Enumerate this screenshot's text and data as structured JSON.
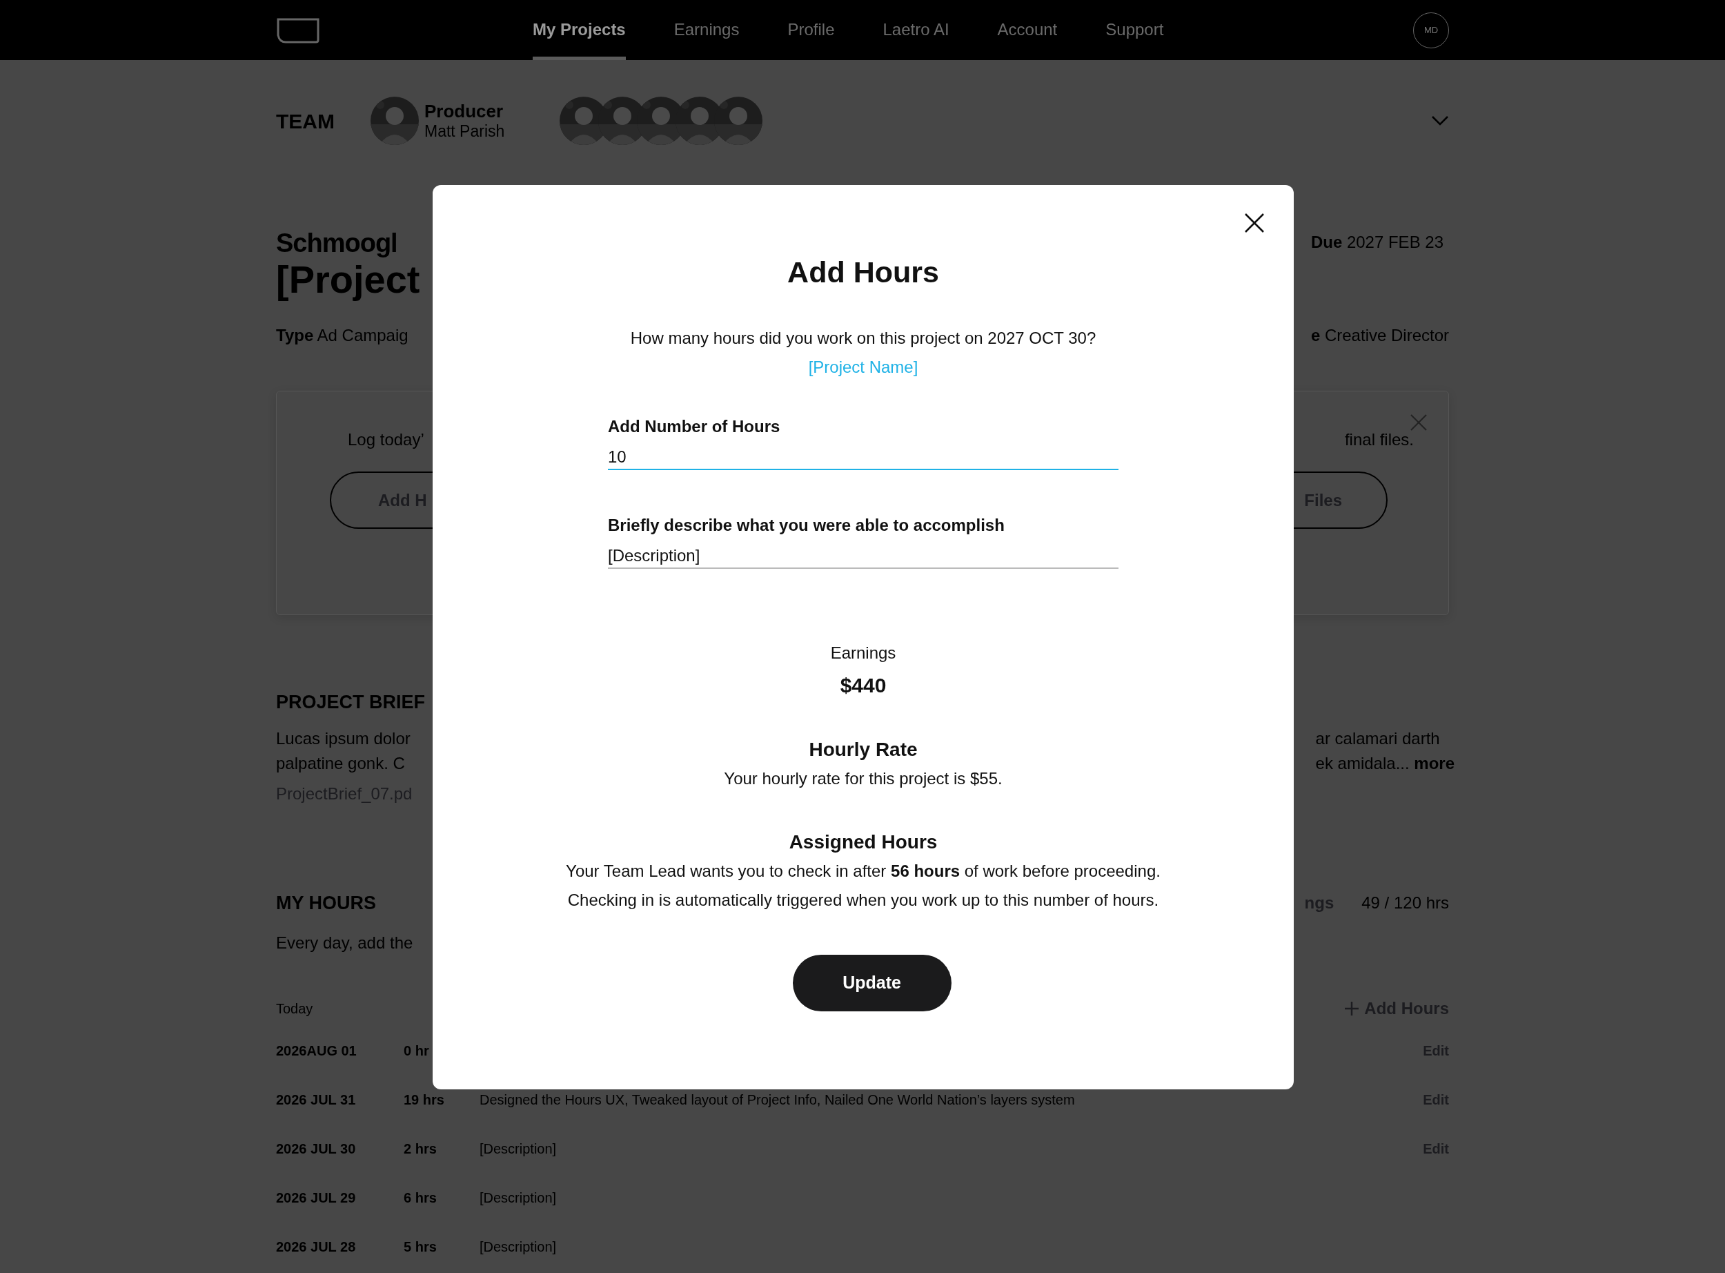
{
  "nav": {
    "items": [
      {
        "label": "My Projects",
        "selected": true
      },
      {
        "label": "Earnings",
        "selected": false
      },
      {
        "label": "Profile",
        "selected": false
      },
      {
        "label": "Laetro AI",
        "selected": false
      },
      {
        "label": "Account",
        "selected": false
      },
      {
        "label": "Support",
        "selected": false
      }
    ],
    "initials": "MD"
  },
  "team": {
    "heading": "TEAM",
    "producer_role": "Producer",
    "producer_name": "Matt Parish"
  },
  "project": {
    "client": "Schmoogl",
    "title": "[Project",
    "due_label": "Due",
    "due": "2027 FEB 23",
    "type_label": "Type",
    "type": "Ad Campaig",
    "role_label": "e",
    "role": "Creative Director"
  },
  "prompt_card": {
    "text_left": "Log today’",
    "button_left": "Add H",
    "text_right": "final files.",
    "button_right": "Files"
  },
  "brief": {
    "heading": "PROJECT BRIEF",
    "lines_left": [
      "Lucas ipsum dolor",
      "palpatine gonk. C"
    ],
    "lines_right": [
      "ar calamari darth",
      "ek amidala... **more**"
    ],
    "file": "ProjectBrief_07.pd"
  },
  "hours": {
    "heading": "MY HOURS",
    "intro": "Every day, add the",
    "tab_partial": "ngs",
    "total": "49 / 120 hrs",
    "today_label": "Today",
    "add_button": "Add Hours",
    "rows": [
      {
        "date": "2026AUG 01",
        "hours": "0 hr",
        "edit": "Edit"
      },
      {
        "date": "2026 JUL 31",
        "hours": "19 hrs",
        "description": "Designed the Hours UX, Tweaked layout of Project Info, Nailed One World Nation’s layers system",
        "edit": "Edit"
      },
      {
        "date": "2026 JUL 30",
        "hours": "2 hrs",
        "description": "[Description]",
        "edit": "Edit"
      },
      {
        "date": "2026 JUL 29",
        "hours": "6 hrs",
        "description": "[Description]"
      },
      {
        "date": "2026 JUL 28",
        "hours": "5 hrs",
        "description": "[Description]"
      }
    ]
  },
  "modal": {
    "title": "Add Hours",
    "question": "How many hours did you work on this project on 2027 OCT 30?",
    "project_link": "[Project Name]",
    "hours_field": {
      "label": "Add Number of Hours",
      "value": "10",
      "focused": true
    },
    "description_field": {
      "label": "Briefly describe what you were able to accomplish",
      "value": "[Description]",
      "focused": false
    },
    "earnings_label": "Earnings",
    "earnings": "$440",
    "rate_heading": "Hourly Rate",
    "rate_text": "Your hourly rate for this project is $55.",
    "assigned_heading": "Assigned Hours",
    "assigned_lines": [
      "Your Team Lead wants you to check in after **56 hours** of work before proceeding.",
      "Checking in is automatically triggered when you work up to this number of hours."
    ],
    "button": "Update"
  }
}
